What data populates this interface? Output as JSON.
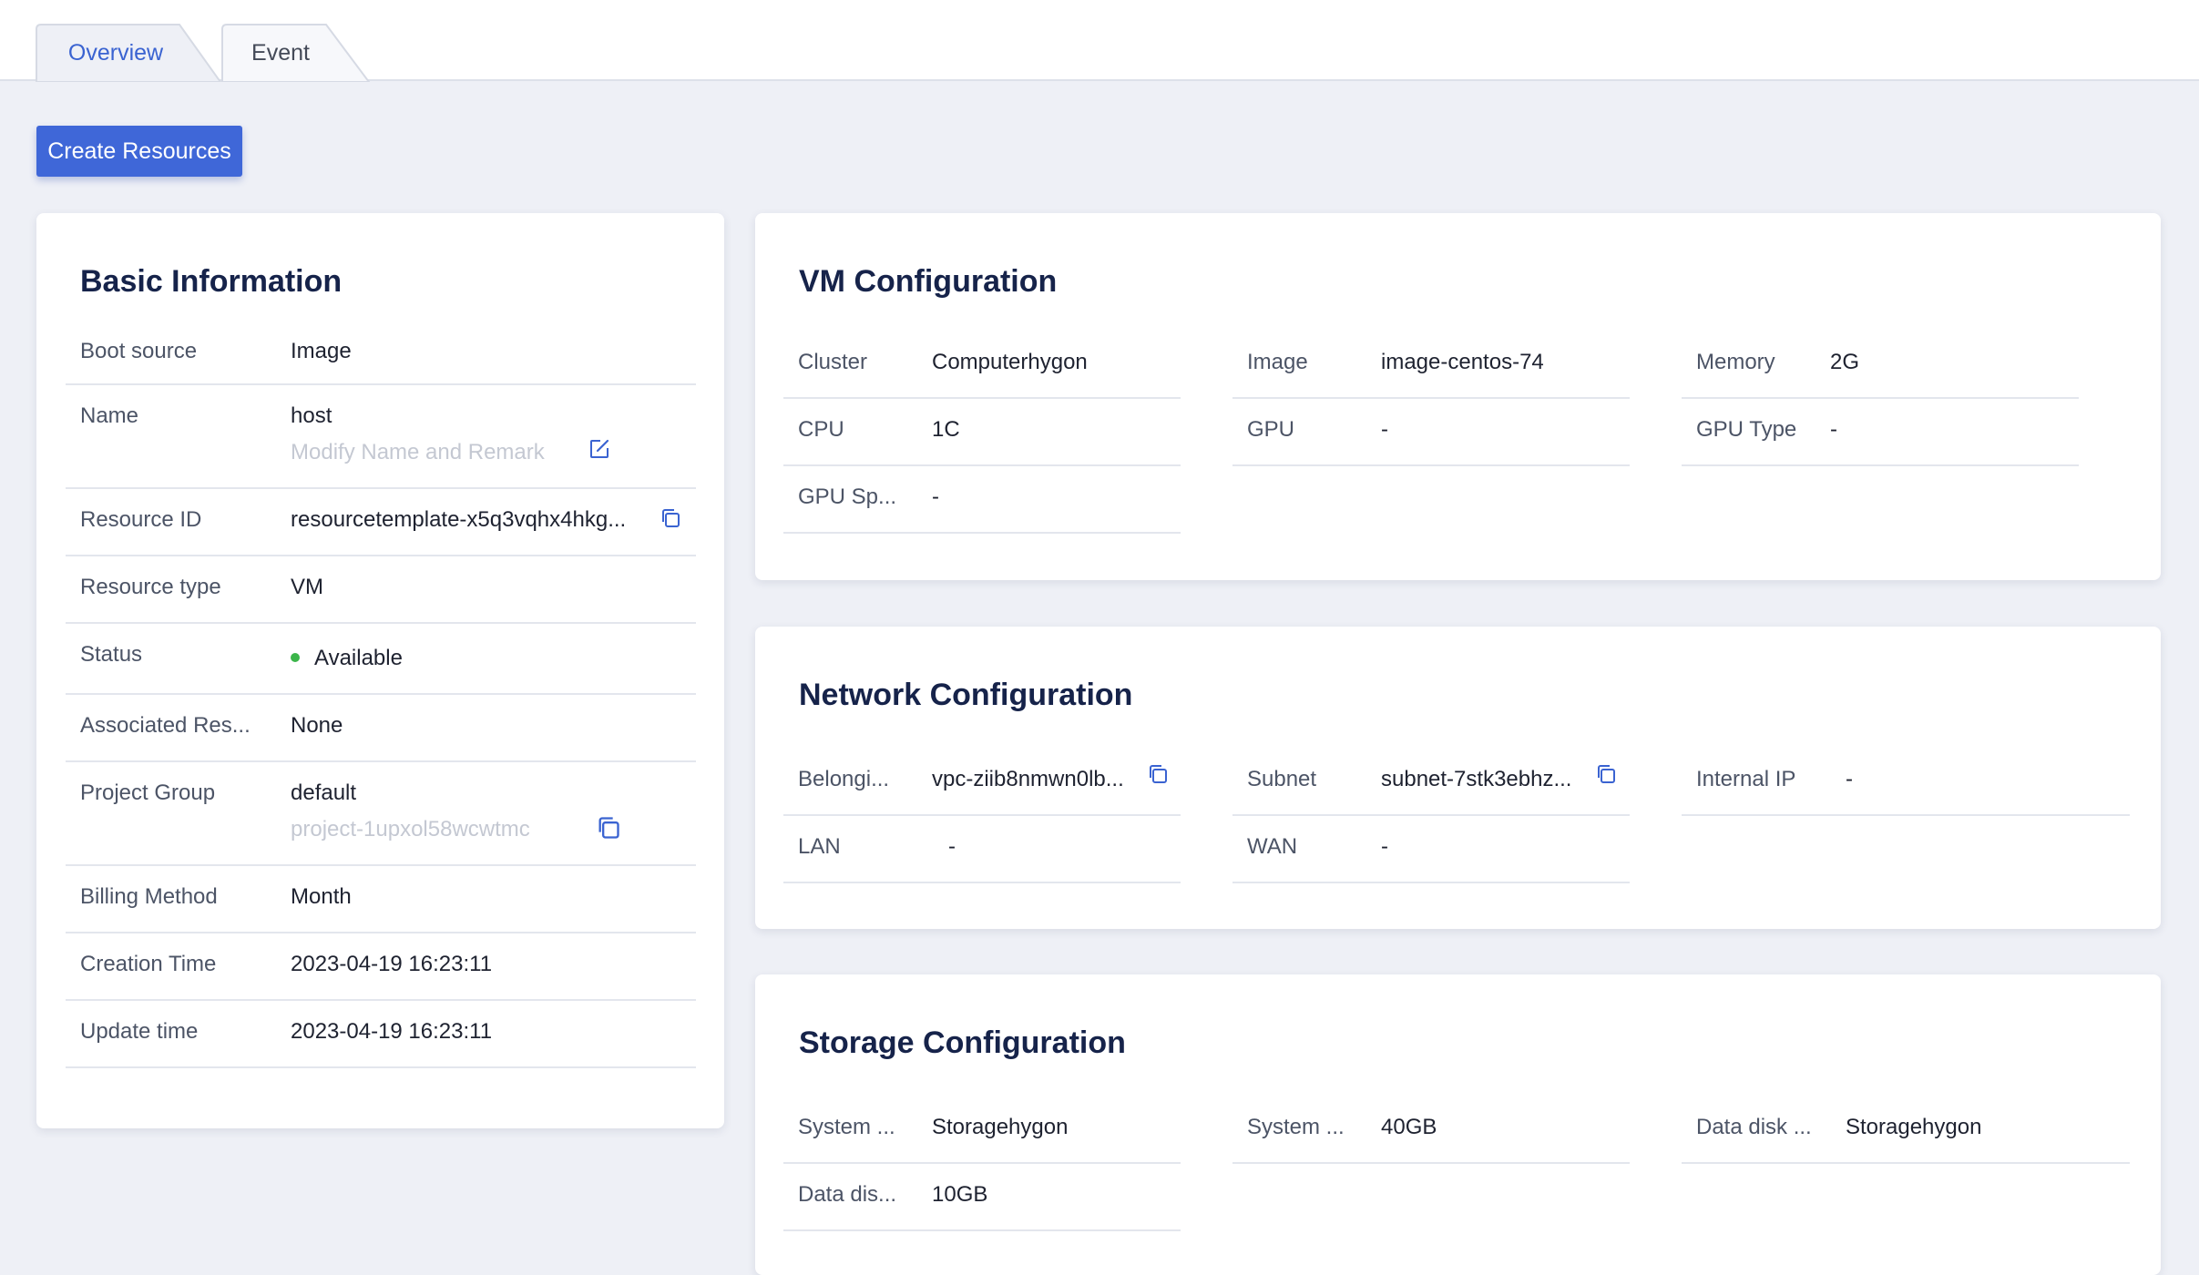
{
  "tabs": [
    {
      "label": "Overview",
      "active": true
    },
    {
      "label": "Event",
      "active": false
    }
  ],
  "toolbar": {
    "create_label": "Create Resources"
  },
  "basic": {
    "title": "Basic Information",
    "boot_source": {
      "label": "Boot source",
      "value": "Image"
    },
    "name": {
      "label": "Name",
      "value": "host",
      "action": "Modify Name and Remark"
    },
    "resource_id": {
      "label": "Resource ID",
      "value": "resourcetemplate-x5q3vqhx4hkg..."
    },
    "resource_type": {
      "label": "Resource type",
      "value": "VM"
    },
    "status": {
      "label": "Status",
      "value": "Available",
      "color": "#3bb54a"
    },
    "associated": {
      "label": "Associated Res...",
      "value": "None"
    },
    "project_group": {
      "label": "Project Group",
      "value": "default",
      "sub": "project-1upxol58wcwtmc"
    },
    "billing": {
      "label": "Billing Method",
      "value": "Month"
    },
    "creation": {
      "label": "Creation Time",
      "value": "2023-04-19 16:23:11"
    },
    "update": {
      "label": "Update time",
      "value": "2023-04-19 16:23:11"
    }
  },
  "vm": {
    "title": "VM Configuration",
    "cluster": {
      "label": "Cluster",
      "value": "Computerhygon"
    },
    "image": {
      "label": "Image",
      "value": "image-centos-74"
    },
    "memory": {
      "label": "Memory",
      "value": "2G"
    },
    "cpu": {
      "label": "CPU",
      "value": "1C"
    },
    "gpu": {
      "label": "GPU",
      "value": "-"
    },
    "gpu_type": {
      "label": "GPU Type",
      "value": "-"
    },
    "gpu_spec": {
      "label": "GPU Sp...",
      "value": "-"
    }
  },
  "network": {
    "title": "Network Configuration",
    "belonging": {
      "label": "Belongi...",
      "value": "vpc-ziib8nmwn0lb..."
    },
    "subnet": {
      "label": "Subnet",
      "value": "subnet-7stk3ebhz..."
    },
    "internal_ip": {
      "label": "Internal IP",
      "value": "-"
    },
    "lan": {
      "label": "LAN",
      "value": "-"
    },
    "wan": {
      "label": "WAN",
      "value": "-"
    }
  },
  "storage": {
    "title": "Storage Configuration",
    "system_type": {
      "label": "System ...",
      "value": "Storagehygon"
    },
    "system_size": {
      "label": "System ...",
      "value": "40GB"
    },
    "data_type": {
      "label": "Data disk ...",
      "value": "Storagehygon"
    },
    "data_size": {
      "label": "Data dis...",
      "value": "10GB"
    }
  },
  "colors": {
    "accent": "#3f67d8",
    "link_icon": "#3a63d1",
    "status_ok": "#3bb54a",
    "background": "#eef0f6",
    "heading": "#16234a"
  },
  "icons": {
    "edit": "edit-icon",
    "copy": "copy-icon",
    "status": "status-dot-icon"
  }
}
